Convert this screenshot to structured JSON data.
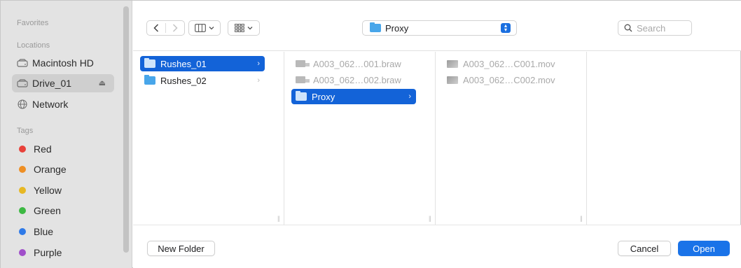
{
  "sidebar": {
    "favorites_heading": "Favorites",
    "locations_heading": "Locations",
    "locations": [
      {
        "label": "Macintosh HD",
        "icon": "drive-icon",
        "selected": false
      },
      {
        "label": "Drive_01",
        "icon": "drive-icon",
        "selected": true
      },
      {
        "label": "Network",
        "icon": "network-icon",
        "selected": false
      }
    ],
    "tags_heading": "Tags",
    "tags": [
      {
        "label": "Red",
        "color": "#e8413a"
      },
      {
        "label": "Orange",
        "color": "#ee8f25"
      },
      {
        "label": "Yellow",
        "color": "#e7b824"
      },
      {
        "label": "Green",
        "color": "#3db943"
      },
      {
        "label": "Blue",
        "color": "#2f7ae8"
      },
      {
        "label": "Purple",
        "color": "#a04fca"
      }
    ]
  },
  "toolbar": {
    "back_icon": "chevron-left-icon",
    "forward_icon": "chevron-right-icon",
    "view_mode_icon": "column-view-icon",
    "group_icon": "grid-icon",
    "path_label": "Proxy",
    "search_placeholder": "Search"
  },
  "columns": [
    {
      "items": [
        {
          "label": "Rushes_01",
          "type": "folder",
          "selected": true
        },
        {
          "label": "Rushes_02",
          "type": "folder",
          "selected": false
        }
      ]
    },
    {
      "items": [
        {
          "label": "A003_062…001.braw",
          "type": "braw",
          "dimmed": true
        },
        {
          "label": "A003_062…002.braw",
          "type": "braw",
          "dimmed": true
        },
        {
          "label": "Proxy",
          "type": "folder",
          "selected": true
        }
      ]
    },
    {
      "items": [
        {
          "label": "A003_062…C001.mov",
          "type": "mov",
          "dimmed": true
        },
        {
          "label": "A003_062…C002.mov",
          "type": "mov",
          "dimmed": true
        }
      ]
    }
  ],
  "bottom": {
    "new_folder_label": "New Folder",
    "cancel_label": "Cancel",
    "open_label": "Open"
  },
  "colors": {
    "accent": "#1363d8",
    "sidebar_bg": "#e3e3e3"
  }
}
